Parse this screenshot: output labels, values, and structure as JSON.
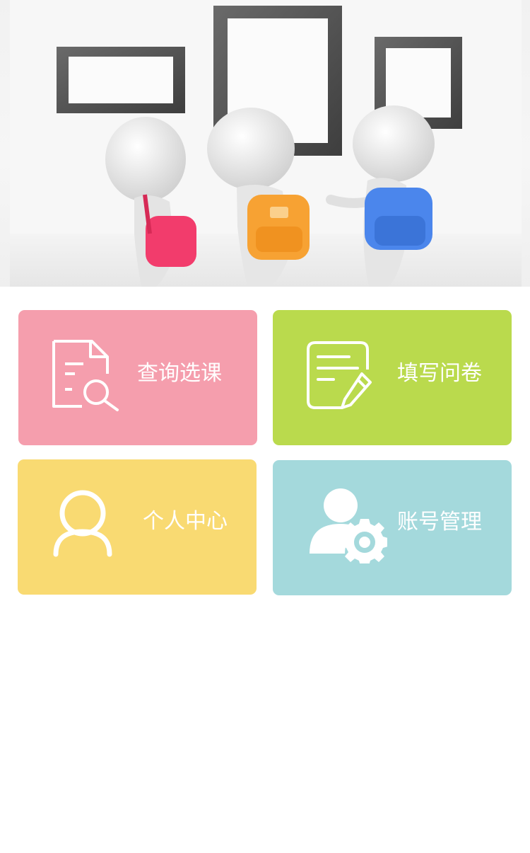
{
  "banner": {
    "image": "three-figures-with-backpacks-viewing-frames"
  },
  "tiles": [
    {
      "label": "查询选课",
      "icon": "document-search-icon",
      "color": "#F59EAD"
    },
    {
      "label": "填写问卷",
      "icon": "document-edit-icon",
      "color": "#BADA4D"
    },
    {
      "label": "个人中心",
      "icon": "user-icon",
      "color": "#F9DA72"
    },
    {
      "label": "账号管理",
      "icon": "user-settings-icon",
      "color": "#A4D9DC"
    }
  ]
}
